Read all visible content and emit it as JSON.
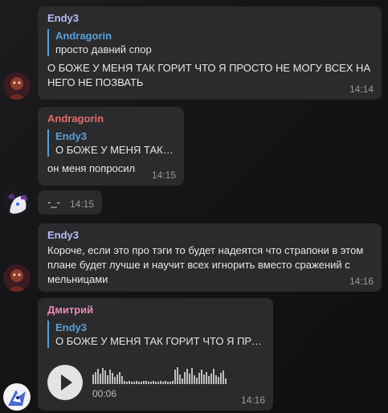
{
  "messages": [
    {
      "sender": "Endy3",
      "sender_color": "#b7bdf8",
      "quote": {
        "name": "Andragorin",
        "text": "просто давний спор"
      },
      "lines": [
        "О БОЖЕ У МЕНЯ ТАК ГОРИТ ЧТО Я ПРОСТО НЕ МОГУ ВСЕХ НА",
        "НЕГО НЕ ПОЗВАТЬ"
      ],
      "time": "14:14"
    },
    {
      "sender": "Andragorin",
      "sender_color": "#e06c6c",
      "quote": {
        "name": "Endy3",
        "text": "О БОЖЕ У МЕНЯ ТАК Г..."
      },
      "lines": [
        "он меня попросил"
      ],
      "time": "14:15"
    },
    {
      "text": "-_-",
      "time": "14:15"
    },
    {
      "sender": "Endy3",
      "sender_color": "#b7bdf8",
      "lines": [
        "Короче, если это про тэги то будет надеятся что страпони в этом",
        "плане будет лучше и научит всех игнорить вместо сражений с",
        "мельницами"
      ],
      "time": "14:16"
    },
    {
      "sender": "Дмитрий",
      "sender_color": "#e88bb5",
      "quote": {
        "name": "Endy3",
        "text": "О БОЖЕ У МЕНЯ ТАК ГОРИТ ЧТО Я ПРОС..."
      },
      "voice": {
        "duration": "00:06"
      },
      "time": "14:16"
    }
  ],
  "waveform_levels": [
    0.55,
    0.7,
    0.85,
    0.6,
    0.9,
    0.75,
    0.5,
    0.8,
    0.65,
    0.4,
    0.55,
    0.7,
    0.45,
    0.2,
    0.15,
    0.18,
    0.12,
    0.15,
    0.2,
    0.14,
    0.12,
    0.16,
    0.18,
    0.15,
    0.13,
    0.2,
    0.15,
    0.12,
    0.18,
    0.14,
    0.16,
    0.12,
    0.15,
    0.18,
    0.8,
    0.95,
    0.55,
    0.3,
    0.7,
    0.85,
    0.6,
    0.9,
    0.5,
    0.35,
    0.65,
    0.8,
    0.55,
    0.7,
    0.45,
    0.6,
    0.85,
    0.5,
    0.4,
    0.65,
    0.75,
    0.3
  ]
}
